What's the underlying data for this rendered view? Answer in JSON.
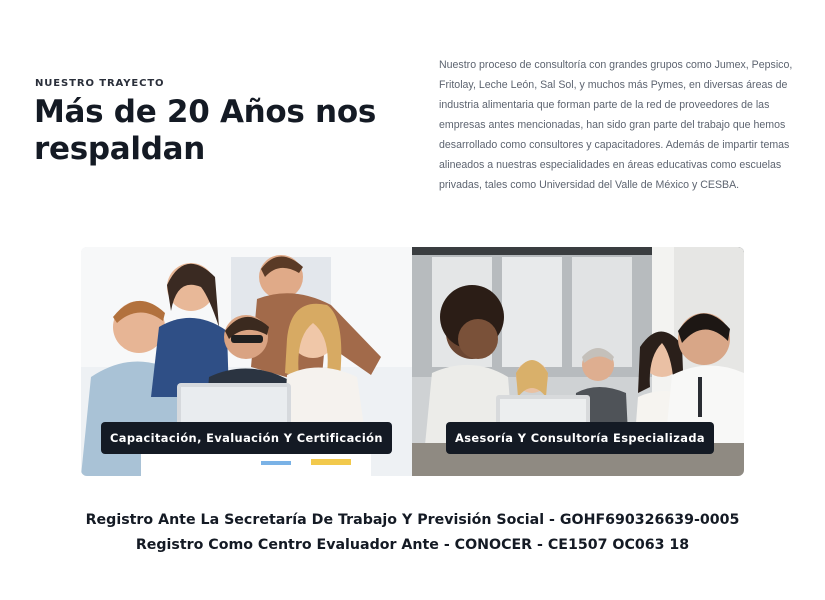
{
  "section": {
    "eyebrow": "NUESTRO TRAYECTO",
    "headline": "Más de 20 Años nos respaldan",
    "description": "Nuestro proceso de consultoría con grandes grupos como Jumex, Pepsico, Fritolay, Leche León, Sal Sol, y muchos más Pymes, en diversas áreas de industria alimentaria que forman parte de la red de proveedores de las empresas antes mencionadas, han sido gran parte del trabajo que hemos desarrollado como consultores y capacitadores. Además de impartir temas alineados a nuestras especialidades en áreas educativas como escuelas privadas, tales como Universidad del Valle de México y CESBA."
  },
  "services": [
    {
      "label": "Capacitación, Evaluación Y Certificación"
    },
    {
      "label": "Asesoría Y Consultoría Especializada"
    }
  ],
  "registros": [
    "Registro Ante La Secretaría De Trabajo Y Previsión Social - GOHF690326639-0005",
    "Registro Como Centro Evaluador Ante - CONOCER - CE1507 OC063 18"
  ],
  "colors": {
    "text_dark": "#141a24",
    "text_muted": "#5d6470",
    "pill_bg": "#141a24"
  }
}
